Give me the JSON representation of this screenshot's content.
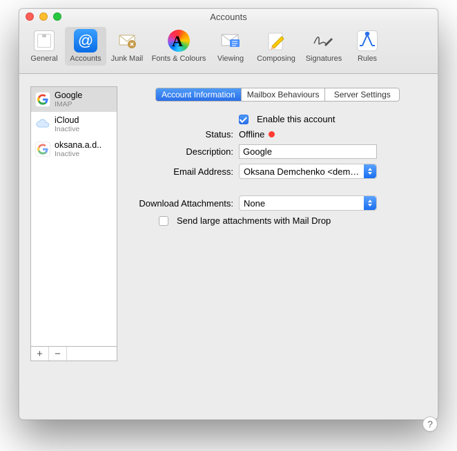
{
  "window": {
    "title": "Accounts"
  },
  "toolbar": {
    "items": [
      {
        "label": "General"
      },
      {
        "label": "Accounts"
      },
      {
        "label": "Junk Mail"
      },
      {
        "label": "Fonts & Colours"
      },
      {
        "label": "Viewing"
      },
      {
        "label": "Composing"
      },
      {
        "label": "Signatures"
      },
      {
        "label": "Rules"
      }
    ]
  },
  "sidebar": {
    "items": [
      {
        "name": "Google",
        "sub": "IMAP"
      },
      {
        "name": "iCloud",
        "sub": "Inactive"
      },
      {
        "name": "oksana.a.d..",
        "sub": "Inactive"
      }
    ],
    "add": "+",
    "remove": "−"
  },
  "tabs": {
    "items": [
      {
        "label": "Account Information"
      },
      {
        "label": "Mailbox Behaviours"
      },
      {
        "label": "Server Settings"
      }
    ]
  },
  "form": {
    "enable_label": "Enable this account",
    "enable_checked": true,
    "status_label": "Status:",
    "status_value": "Offline",
    "description_label": "Description:",
    "description_value": "Google",
    "email_label": "Email Address:",
    "email_value": "Oksana Demchenko <demchen…",
    "download_label": "Download Attachments:",
    "download_value": "None",
    "maildrop_label": "Send large attachments with Mail Drop",
    "maildrop_checked": false
  },
  "help": "?"
}
